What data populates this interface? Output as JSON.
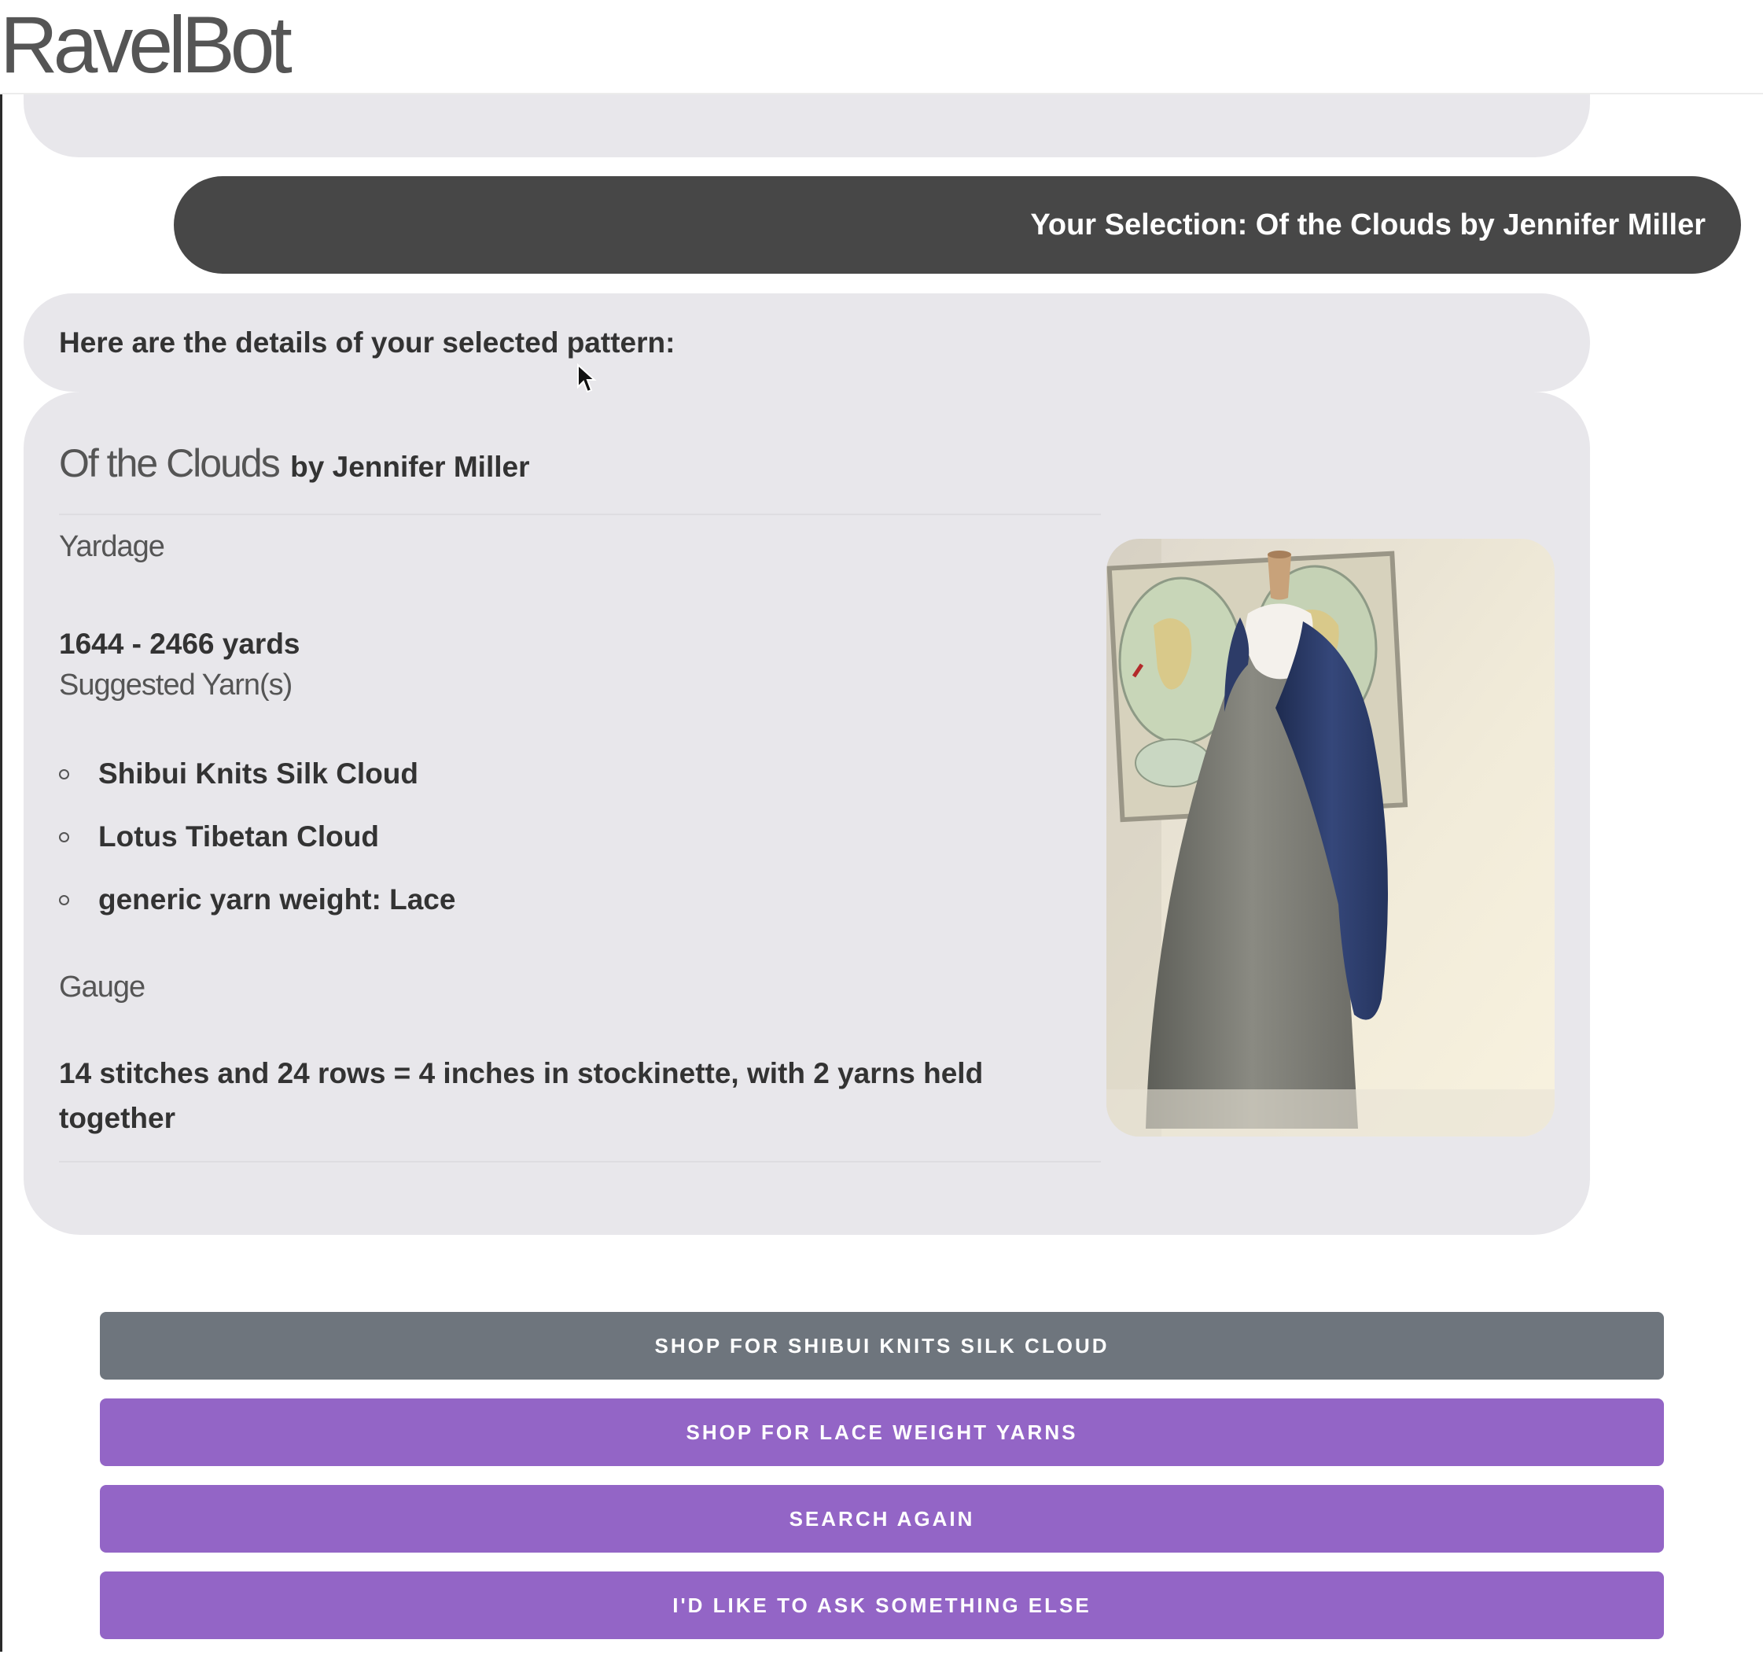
{
  "app": {
    "brand": "RavelBot"
  },
  "chat": {
    "selection": "Your Selection: Of the Clouds by Jennifer Miller",
    "intro": "Here are the details of your selected pattern:"
  },
  "pattern": {
    "name": "Of the Clouds",
    "author": "by Jennifer Miller",
    "yardage_label": "Yardage",
    "yardage_value": "1644 - 2466 yards",
    "yarns_label": "Suggested Yarn(s)",
    "yarns": [
      "Shibui Knits Silk Cloud",
      "Lotus Tibetan Cloud",
      "generic yarn weight: Lace"
    ],
    "gauge_label": "Gauge",
    "gauge_value": "14 stitches and 24 rows = 4 inches in stockinette, with 2 yarns held together"
  },
  "actions": [
    "SHOP FOR SHIBUI KNITS SILK CLOUD",
    "SHOP FOR LACE WEIGHT YARNS",
    "SEARCH AGAIN",
    "I'D LIKE TO ASK SOMETHING ELSE"
  ],
  "colors": {
    "user_bubble": "#474747",
    "bot_bubble": "#e8e7eb",
    "primary_action": "#9365c6",
    "secondary_action": "#6e757d"
  }
}
